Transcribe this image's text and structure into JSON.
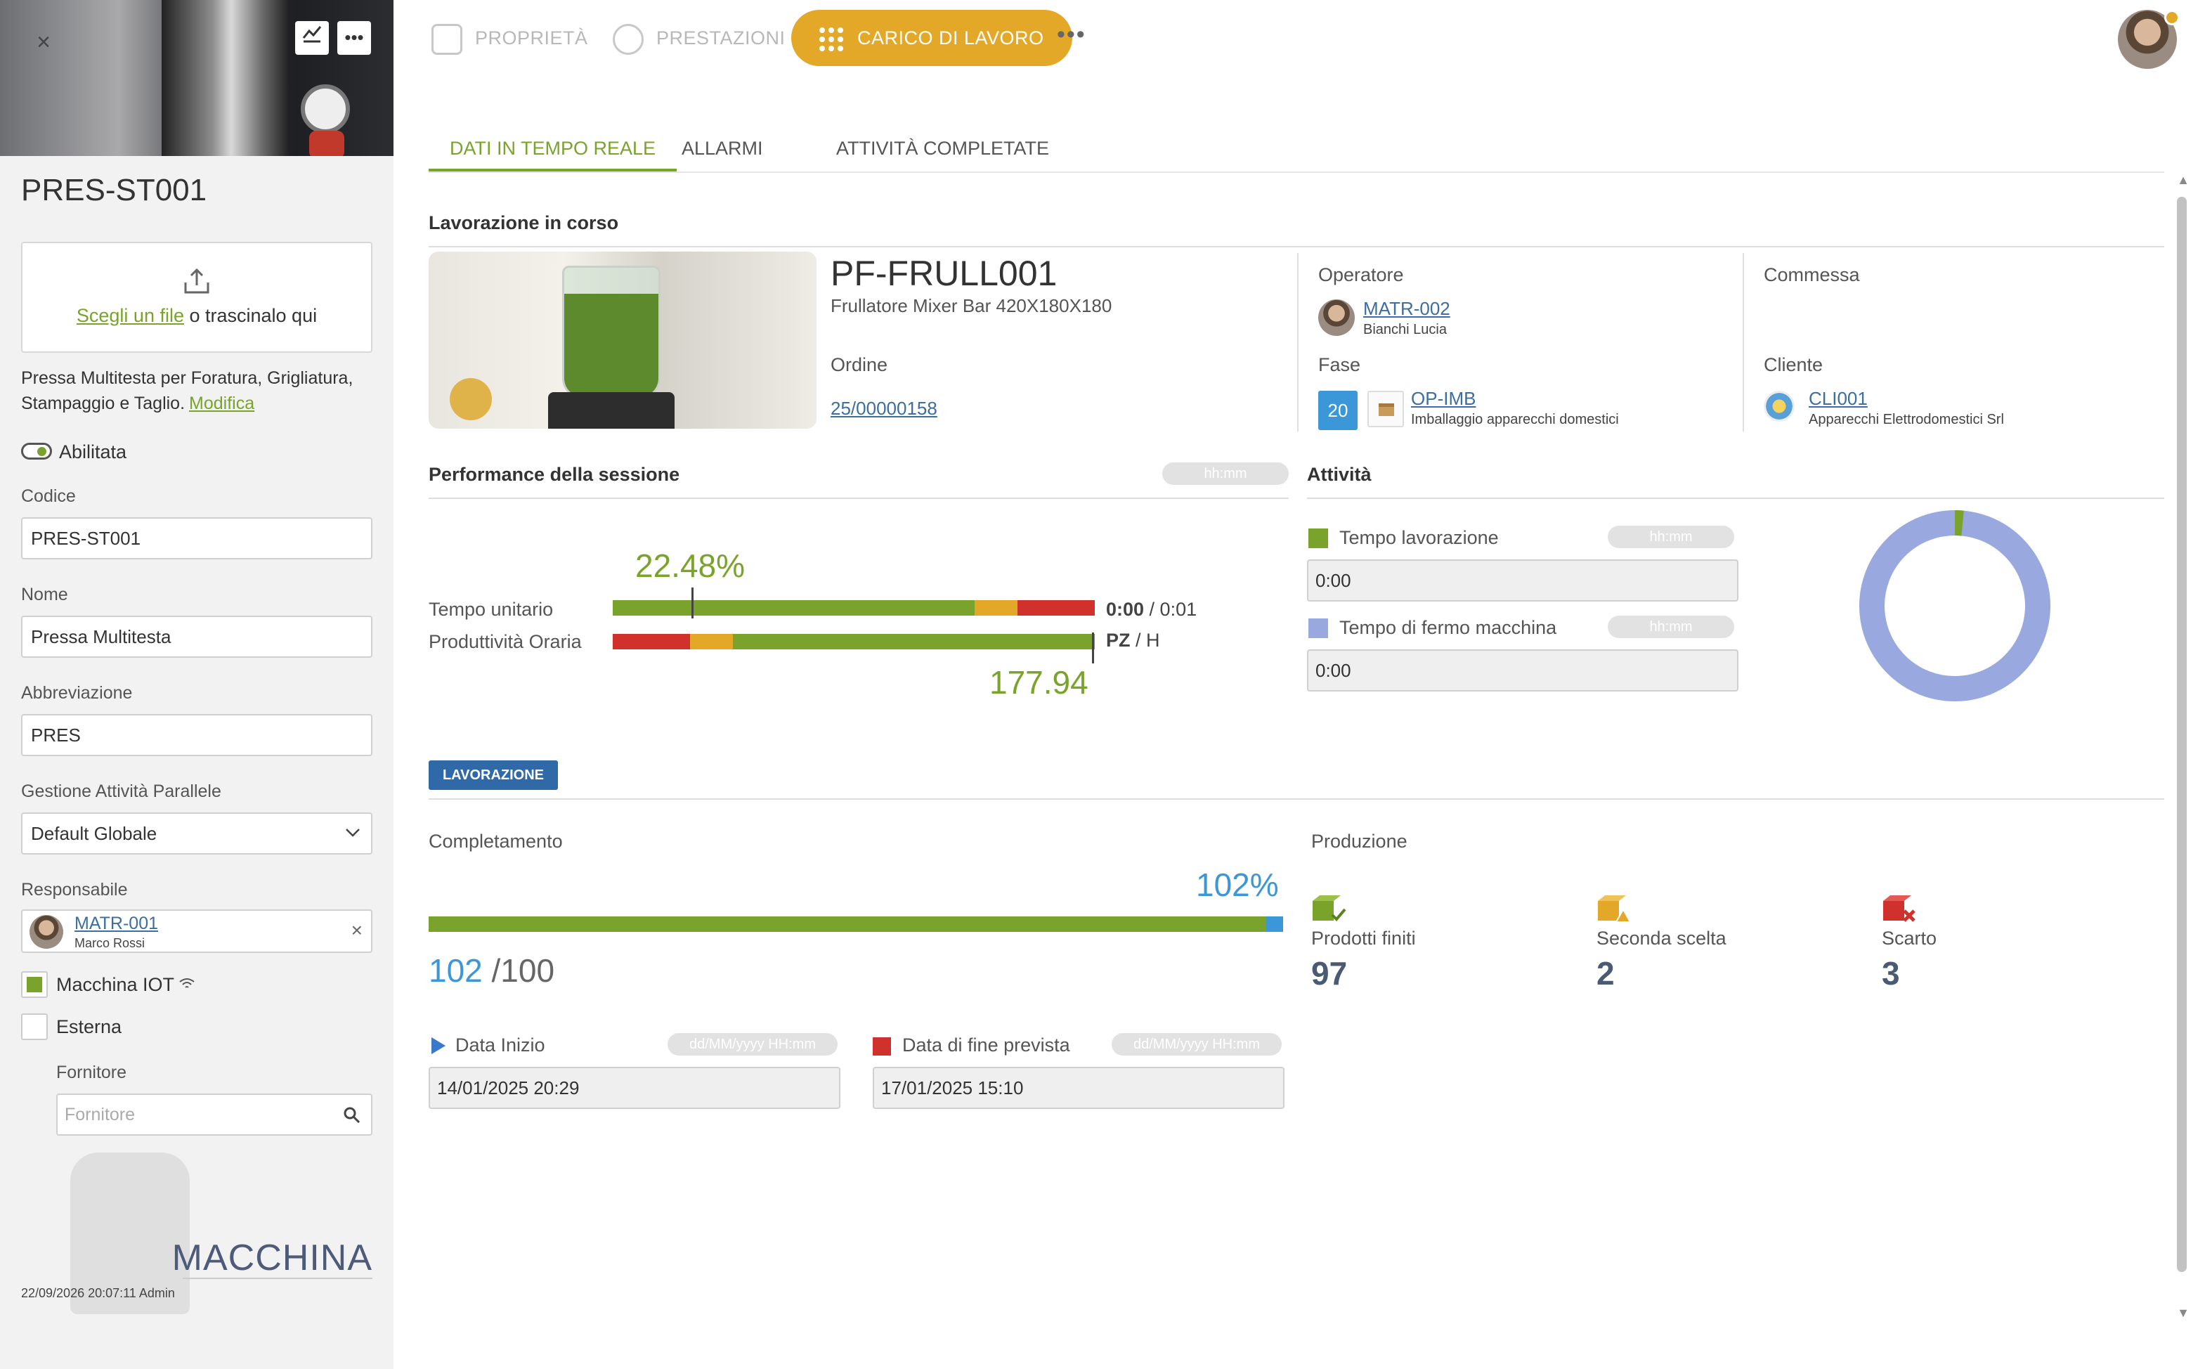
{
  "sidebar": {
    "title": "PRES-ST001",
    "upload": {
      "link": "Scegli un file",
      "text": " o trascinalo qui"
    },
    "description": "Pressa Multitesta per Foratura, Grigliatura, Stampaggio e Taglio.",
    "modify_link": "Modifica",
    "enabled_label": "Abilitata",
    "codice_label": "Codice",
    "codice_value": "PRES-ST001",
    "nome_label": "Nome",
    "nome_value": "Pressa Multitesta",
    "abbr_label": "Abbreviazione",
    "abbr_value": "PRES",
    "gestione_label": "Gestione Attività Parallele",
    "gestione_value": "Default Globale",
    "resp_label": "Responsabile",
    "resp_code": "MATR-001",
    "resp_name": "Marco Rossi",
    "iot_label": "Macchina IOT",
    "esterna_label": "Esterna",
    "fornitore_label": "Fornitore",
    "fornitore_placeholder": "Fornitore",
    "type": "MACCHINA",
    "timestamp": "22/09/2026 20:07:11 Admin"
  },
  "topbar": {
    "tabs": [
      "PROPRIETÀ",
      "PRESTAZIONI",
      "CARICO DI LAVORO"
    ],
    "active": "CARICO DI LAVORO"
  },
  "subtabs": [
    "DATI IN TEMPO REALE",
    "ALLARMI",
    "ATTIVITÀ COMPLETATE"
  ],
  "lavorazione": {
    "section": "Lavorazione in corso",
    "product_code": "PF-FRULL001",
    "product_desc": "Frullatore Mixer Bar 420X180X180",
    "ordine_label": "Ordine",
    "ordine_value": "25/00000158",
    "operatore_label": "Operatore",
    "operatore_code": "MATR-002",
    "operatore_name": "Bianchi Lucia",
    "fase_label": "Fase",
    "fase_num": "20",
    "fase_code": "OP-IMB",
    "fase_desc": "Imballaggio apparecchi domestici",
    "commessa_label": "Commessa",
    "cliente_label": "Cliente",
    "cliente_code": "CLI001",
    "cliente_name": "Apparecchi Elettrodomestici Srl"
  },
  "performance": {
    "section": "Performance della sessione",
    "pill": "hh:mm",
    "percent": "22.48%",
    "tempo_label": "Tempo unitario",
    "tempo_value_bold": "0:00",
    "tempo_value_rest": " / 0:01",
    "prod_label": "Produttività Oraria",
    "prod_unit_bold": "PZ",
    "prod_unit_rest": " / H",
    "prod_value": "177.94"
  },
  "attivita": {
    "section": "Attività",
    "lav_label": "Tempo lavorazione",
    "lav_value": "0:00",
    "fermo_label": "Tempo di fermo macchina",
    "fermo_value": "0:00",
    "pill": "hh:mm",
    "colors": {
      "lavorazione": "#7aa32c",
      "fermo": "#9aa8e0"
    },
    "donut": {
      "lavorazione_fraction": 0.015,
      "fermo_fraction": 0.985
    }
  },
  "lavorazione_box": {
    "badge": "LAVORAZIONE",
    "completamento_label": "Completamento",
    "percent": "102%",
    "done": "102",
    "total": "/100",
    "data_inizio_label": "Data Inizio",
    "data_inizio_value": "14/01/2025 20:29",
    "data_fine_label": "Data di fine prevista",
    "data_fine_value": "17/01/2025 15:10",
    "date_pill": "dd/MM/yyyy HH:mm"
  },
  "produzione": {
    "label": "Produzione",
    "items": [
      {
        "name": "Prodotti finiti",
        "value": "97",
        "icon": "box-check-icon",
        "color": "#7aa32c"
      },
      {
        "name": "Seconda scelta",
        "value": "2",
        "icon": "box-warning-icon",
        "color": "#e3a828"
      },
      {
        "name": "Scarto",
        "value": "3",
        "icon": "box-x-icon",
        "color": "#d0312d"
      }
    ]
  }
}
